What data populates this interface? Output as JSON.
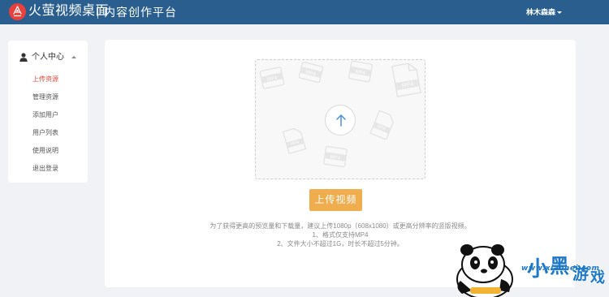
{
  "header": {
    "app_name": "火萤视频桌面",
    "platform_name": "内容创作平台",
    "user_name": "林木森森",
    "brand_color": "#2a5e8e",
    "logo_color": "#e8403c"
  },
  "sidebar": {
    "section_title": "个人中心",
    "items": [
      {
        "label": "上传资源",
        "active": true
      },
      {
        "label": "管理资源",
        "active": false
      },
      {
        "label": "添加用户",
        "active": false
      },
      {
        "label": "用户列表",
        "active": false
      },
      {
        "label": "使用说明",
        "active": false
      },
      {
        "label": "退出登录",
        "active": false
      }
    ],
    "active_color": "#e2473c"
  },
  "upload": {
    "button_label": "上传视频",
    "button_color": "#f0ad4e",
    "decor_icon_label": "MP4",
    "notes": [
      "为了获得更高的预览量和下载量，建议上传1080p（608x1080）或更高分辨率的竖版视频。",
      "1、格式仅支持MP4",
      "2、文件大小不超过1G，时长不超过5分钟。"
    ]
  },
  "watermark": {
    "title": "小黑游戏",
    "url": "www.xiaohei.com"
  }
}
